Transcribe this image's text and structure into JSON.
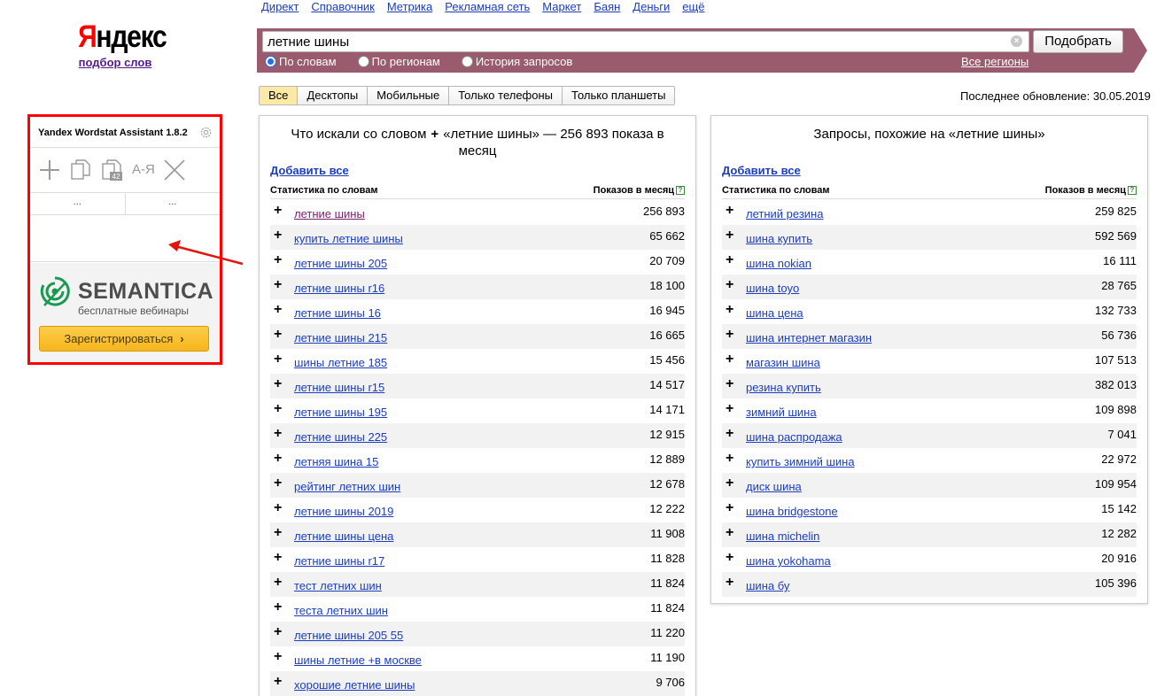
{
  "logo": {
    "ya": "Я",
    "rest": "ндекс",
    "subtitle": "подбор слов"
  },
  "topnav": [
    "Директ",
    "Справочник",
    "Метрика",
    "Рекламная сеть",
    "Маркет",
    "Баян",
    "Деньги",
    "ещё"
  ],
  "search": {
    "value": "летние шины",
    "button": "Подобрать",
    "radios": [
      {
        "label": "По словам",
        "checked": true
      },
      {
        "label": "По регионам",
        "checked": false
      },
      {
        "label": "История запросов",
        "checked": false
      }
    ],
    "all_regions": "Все регионы"
  },
  "device_tabs": [
    {
      "label": "Все",
      "active": true
    },
    {
      "label": "Десктопы",
      "active": false
    },
    {
      "label": "Мобильные",
      "active": false
    },
    {
      "label": "Только телефоны",
      "active": false
    },
    {
      "label": "Только планшеты",
      "active": false
    }
  ],
  "updated": "Последнее обновление: 30.05.2019",
  "left_panel": {
    "title_pre": "Что искали со словом",
    "title_plus": "+",
    "title_post": "«летние шины» — 256 893 показа в месяц",
    "add_all": "Добавить все",
    "col_phrase": "Статистика по словам",
    "col_count": "Показов в месяц",
    "help": "?",
    "rows": [
      {
        "phrase": "летние шины",
        "count": "256 893",
        "visited": true
      },
      {
        "phrase": "купить летние шины",
        "count": "65 662"
      },
      {
        "phrase": "летние шины 205",
        "count": "20 709"
      },
      {
        "phrase": "летние шины r16",
        "count": "18 100"
      },
      {
        "phrase": "летние шины 16",
        "count": "16 945"
      },
      {
        "phrase": "летние шины 215",
        "count": "16 665"
      },
      {
        "phrase": "шины летние 185",
        "count": "15 456"
      },
      {
        "phrase": "летние шины r15",
        "count": "14 517"
      },
      {
        "phrase": "летние шины 195",
        "count": "14 171"
      },
      {
        "phrase": "летние шины 225",
        "count": "12 915"
      },
      {
        "phrase": "летняя шина 15",
        "count": "12 889"
      },
      {
        "phrase": "рейтинг летних шин",
        "count": "12 678"
      },
      {
        "phrase": "летние шины 2019",
        "count": "12 222"
      },
      {
        "phrase": "летние шины цена",
        "count": "11 908"
      },
      {
        "phrase": "летние шины r17",
        "count": "11 828"
      },
      {
        "phrase": "тест летних шин",
        "count": "11 824"
      },
      {
        "phrase": "теста летних шин",
        "count": "11 824"
      },
      {
        "phrase": "летние шины 205 55",
        "count": "11 220"
      },
      {
        "phrase": "шины летние +в москве",
        "count": "11 190"
      },
      {
        "phrase": "хорошие летние шины",
        "count": "9 706"
      }
    ]
  },
  "right_panel": {
    "title": "Запросы, похожие на «летние шины»",
    "add_all": "Добавить все",
    "col_phrase": "Статистика по словам",
    "col_count": "Показов в месяц",
    "help": "?",
    "rows": [
      {
        "phrase": "летний резина",
        "count": "259 825"
      },
      {
        "phrase": "шина купить",
        "count": "592 569"
      },
      {
        "phrase": "шина nokian",
        "count": "16 111"
      },
      {
        "phrase": "шина toyo",
        "count": "28 765"
      },
      {
        "phrase": "шина цена",
        "count": "132 733"
      },
      {
        "phrase": "шина интернет магазин",
        "count": "56 736"
      },
      {
        "phrase": "магазин шина",
        "count": "107 513"
      },
      {
        "phrase": "резина купить",
        "count": "382 013"
      },
      {
        "phrase": "зимний шина",
        "count": "109 898"
      },
      {
        "phrase": "шина распродажа",
        "count": "7 041"
      },
      {
        "phrase": "купить зимний шина",
        "count": "22 972"
      },
      {
        "phrase": "диск шина",
        "count": "109 954"
      },
      {
        "phrase": "шина bridgestone",
        "count": "15 142"
      },
      {
        "phrase": "шина michelin",
        "count": "12 282"
      },
      {
        "phrase": "шина yokohama",
        "count": "20 916"
      },
      {
        "phrase": "шина бу",
        "count": "105 396"
      }
    ]
  },
  "extension": {
    "title": "Yandex Wordstat Assistant 1.8.2",
    "tool_icons": [
      "plus-icon",
      "copy-icon",
      "copy-with-count-icon",
      "sort-az-icon",
      "clear-icon"
    ],
    "sort_label": "А-Я",
    "count_badge": "42",
    "col_left": "...",
    "col_right": "...",
    "ad": {
      "brand": "SEMANTICA",
      "subtitle": "бесплатные вебинары",
      "button": "Зарегистрироваться"
    }
  },
  "colors": {
    "band": "#9a5b6f",
    "link": "#1a3dc1",
    "highlight_border": "#ff0000",
    "semantica_green": "#1a9a50",
    "register_button": "#f6b61d"
  }
}
